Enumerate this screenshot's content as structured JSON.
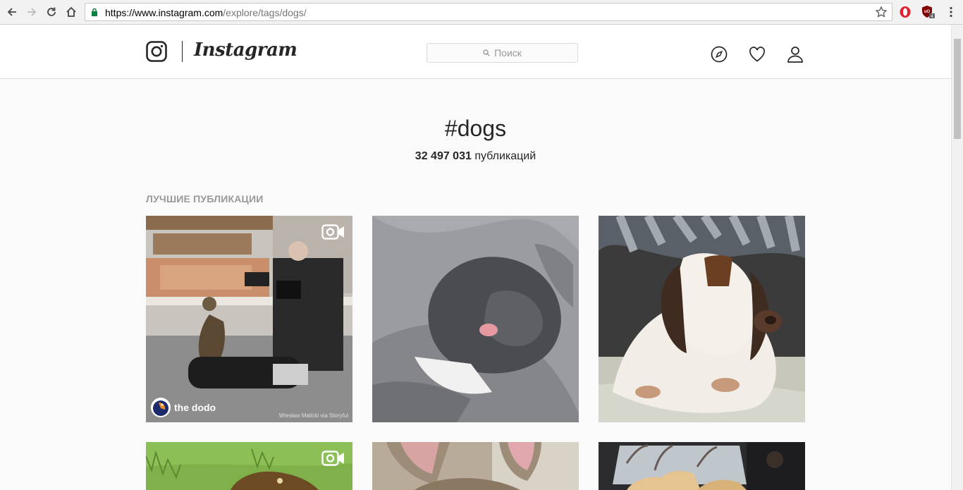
{
  "browser": {
    "url_scheme_host": "https://www.instagram.com",
    "url_path": "/explore/tags/dogs/",
    "ext_badge": "4"
  },
  "header": {
    "wordmark": "Instagram",
    "search_placeholder": "Поиск"
  },
  "tag": {
    "title": "#dogs",
    "count": "32 497 031",
    "count_label": "публикаций"
  },
  "section": {
    "label": "ЛУЧШИЕ ПУБЛИКАЦИИ"
  },
  "posts": [
    {
      "type": "video",
      "overlay_brand": "the dodo",
      "credit": "Wiesław Malicki via Storyful"
    },
    {
      "type": "photo"
    },
    {
      "type": "photo"
    },
    {
      "type": "video"
    },
    {
      "type": "photo"
    },
    {
      "type": "photo"
    }
  ],
  "colors": {
    "accent_green": "#0b8043",
    "opera_red": "#e0242f",
    "ublock_red": "#800000",
    "text": "#262626",
    "muted": "#999999"
  }
}
